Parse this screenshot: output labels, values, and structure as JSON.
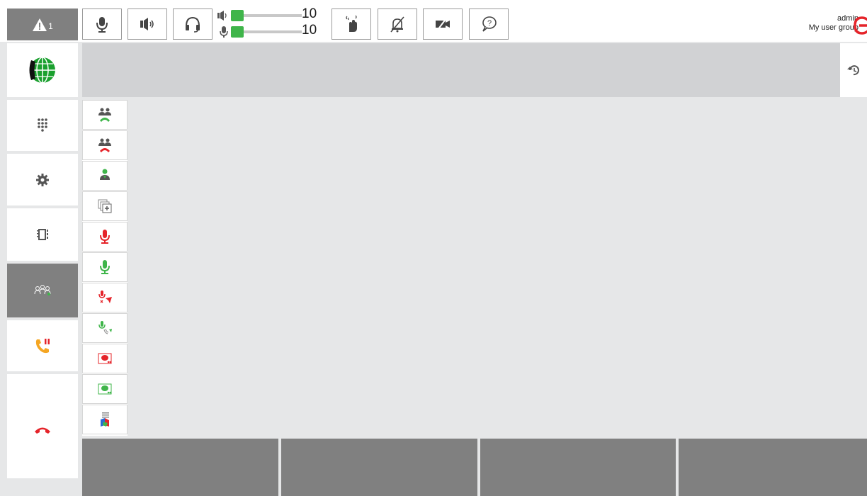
{
  "toolbar": {
    "alarm": {
      "count": "1",
      "icon": "warning-icon"
    },
    "buttons": [
      {
        "name": "microphone-button",
        "icon": "microphone-icon"
      },
      {
        "name": "speaker-button",
        "icon": "speaker-icon"
      },
      {
        "name": "headset-button",
        "icon": "headset-icon"
      },
      {
        "name": "gesture-button",
        "icon": "hand-wave-icon"
      },
      {
        "name": "mute-ringer-button",
        "icon": "bell-off-icon"
      },
      {
        "name": "video-off-button",
        "icon": "video-off-icon"
      },
      {
        "name": "help-button",
        "icon": "help-bubble-icon"
      }
    ],
    "volume": {
      "speaker_value": "10",
      "mic_value": "10",
      "speaker_level": 0,
      "mic_level": 0,
      "knob_color": "#3fb54a"
    }
  },
  "user": {
    "name": "admin",
    "group": "My user group",
    "logout_icon": "logout-icon",
    "logout_color": "#e5242a"
  },
  "sidebar": {
    "items": [
      {
        "name": "sidebar-item-network",
        "icon": "globe-phone-icon",
        "active": false
      },
      {
        "name": "sidebar-item-keypad",
        "icon": "keypad-icon",
        "active": false
      },
      {
        "name": "sidebar-item-settings",
        "icon": "gear-icon",
        "active": false
      },
      {
        "name": "sidebar-item-phonebook",
        "icon": "address-book-icon",
        "active": false
      },
      {
        "name": "sidebar-item-conference",
        "icon": "group-icon",
        "active": true
      },
      {
        "name": "sidebar-item-hold",
        "icon": "call-hold-icon",
        "active": false
      },
      {
        "name": "sidebar-item-hangup",
        "icon": "hang-up-icon",
        "active": false
      }
    ]
  },
  "conference_tools": [
    {
      "name": "group-call-answer-button",
      "icon": "group-answer-icon"
    },
    {
      "name": "group-call-end-button",
      "icon": "group-hangup-icon"
    },
    {
      "name": "add-participant-button",
      "icon": "person-add-icon"
    },
    {
      "name": "new-window-button",
      "icon": "windows-plus-icon"
    },
    {
      "name": "mute-mic-button",
      "icon": "mic-red-icon"
    },
    {
      "name": "unmute-mic-button",
      "icon": "mic-green-icon"
    },
    {
      "name": "mute-all-button",
      "icon": "mic-mute-all-icon"
    },
    {
      "name": "unmute-all-button",
      "icon": "mic-unmute-all-icon"
    },
    {
      "name": "record-stop-button",
      "icon": "record-red-icon"
    },
    {
      "name": "record-start-button",
      "icon": "record-green-icon"
    },
    {
      "name": "layout-button",
      "icon": "color-layout-icon"
    }
  ],
  "colors": {
    "active_nav": "#808080",
    "status_bar": "#d1d2d4",
    "content_bg": "#e6e7e8",
    "function_key": "#808080",
    "accent_red": "#e5242a",
    "accent_green": "#3fb54a",
    "accent_orange": "#f5a623"
  }
}
